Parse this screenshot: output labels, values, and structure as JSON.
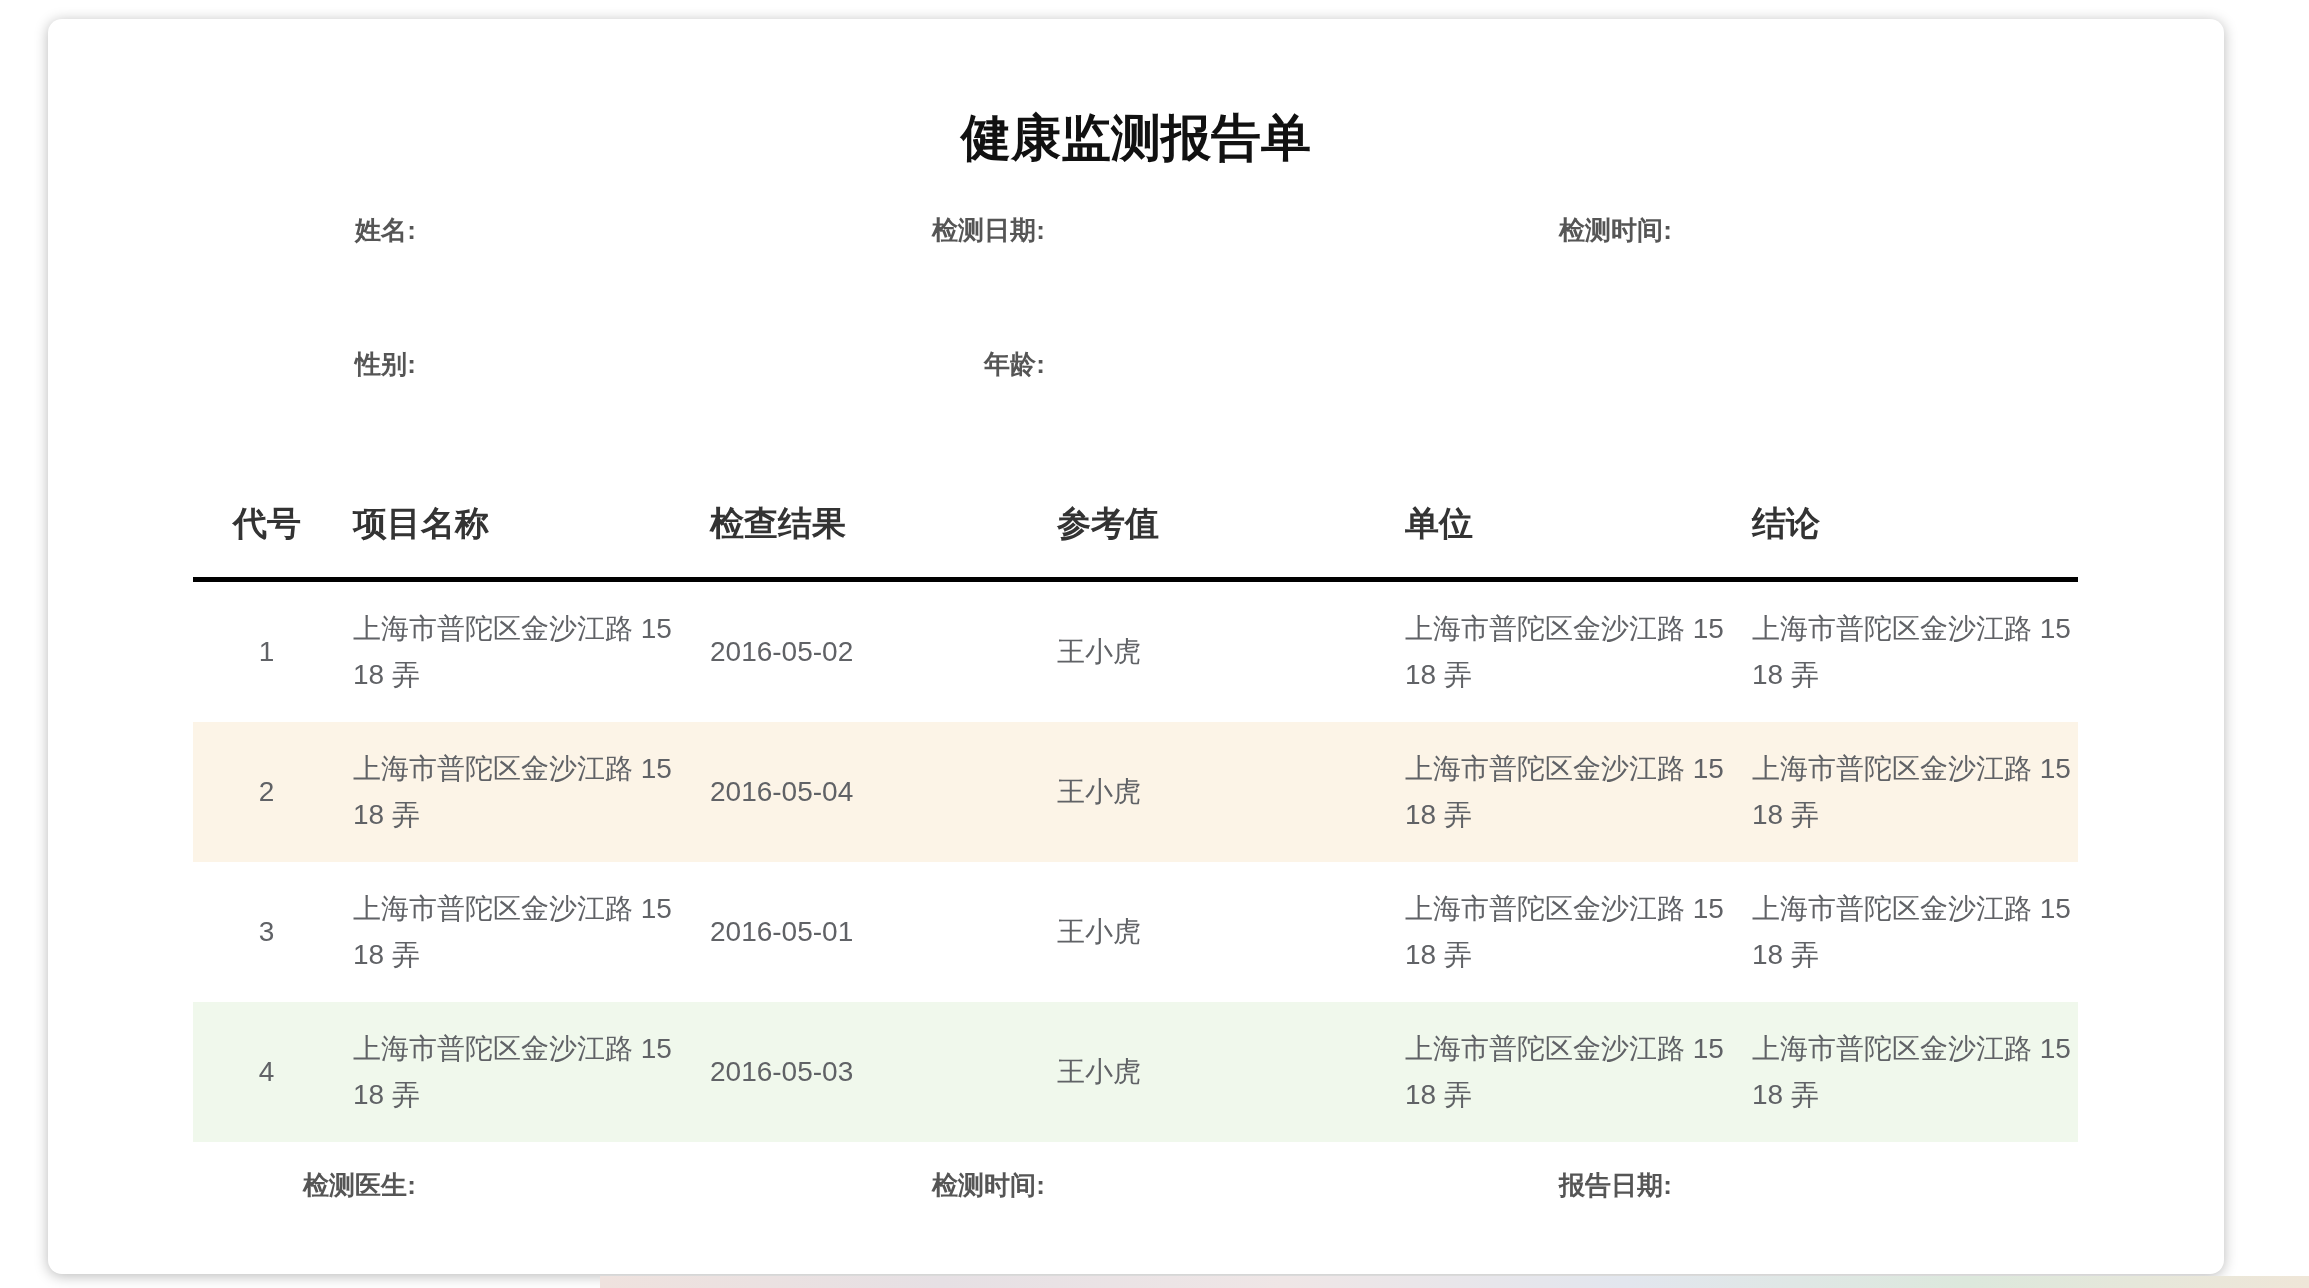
{
  "title": "健康监测报告单",
  "info_rows": [
    [
      {
        "label": "姓名:"
      },
      {
        "label": "检测日期:"
      },
      {
        "label": "检测时间:"
      }
    ],
    [
      {
        "label": "性别:"
      },
      {
        "label": "年龄:"
      }
    ]
  ],
  "table": {
    "columns": [
      "代号",
      "项目名称",
      "检查结果",
      "参考值",
      "单位",
      "结论"
    ],
    "rows": [
      {
        "kind": "plain",
        "cells": [
          "1",
          "上海市普陀区金沙江路 1518 弄",
          "2016-05-02",
          "王小虎",
          "上海市普陀区金沙江路 1518 弄",
          "上海市普陀区金沙江路 1518 弄"
        ]
      },
      {
        "kind": "warning",
        "cells": [
          "2",
          "上海市普陀区金沙江路 1518 弄",
          "2016-05-04",
          "王小虎",
          "上海市普陀区金沙江路 1518 弄",
          "上海市普陀区金沙江路 1518 弄"
        ]
      },
      {
        "kind": "plain",
        "cells": [
          "3",
          "上海市普陀区金沙江路 1518 弄",
          "2016-05-01",
          "王小虎",
          "上海市普陀区金沙江路 1518 弄",
          "上海市普陀区金沙江路 1518 弄"
        ]
      },
      {
        "kind": "success",
        "cells": [
          "4",
          "上海市普陀区金沙江路 1518 弄",
          "2016-05-03",
          "王小虎",
          "上海市普陀区金沙江路 1518 弄",
          "上海市普陀区金沙江路 1518 弄"
        ]
      }
    ]
  },
  "footer": [
    {
      "label": "检测医生:"
    },
    {
      "label": "检测时间:"
    },
    {
      "label": "报告日期:"
    }
  ]
}
